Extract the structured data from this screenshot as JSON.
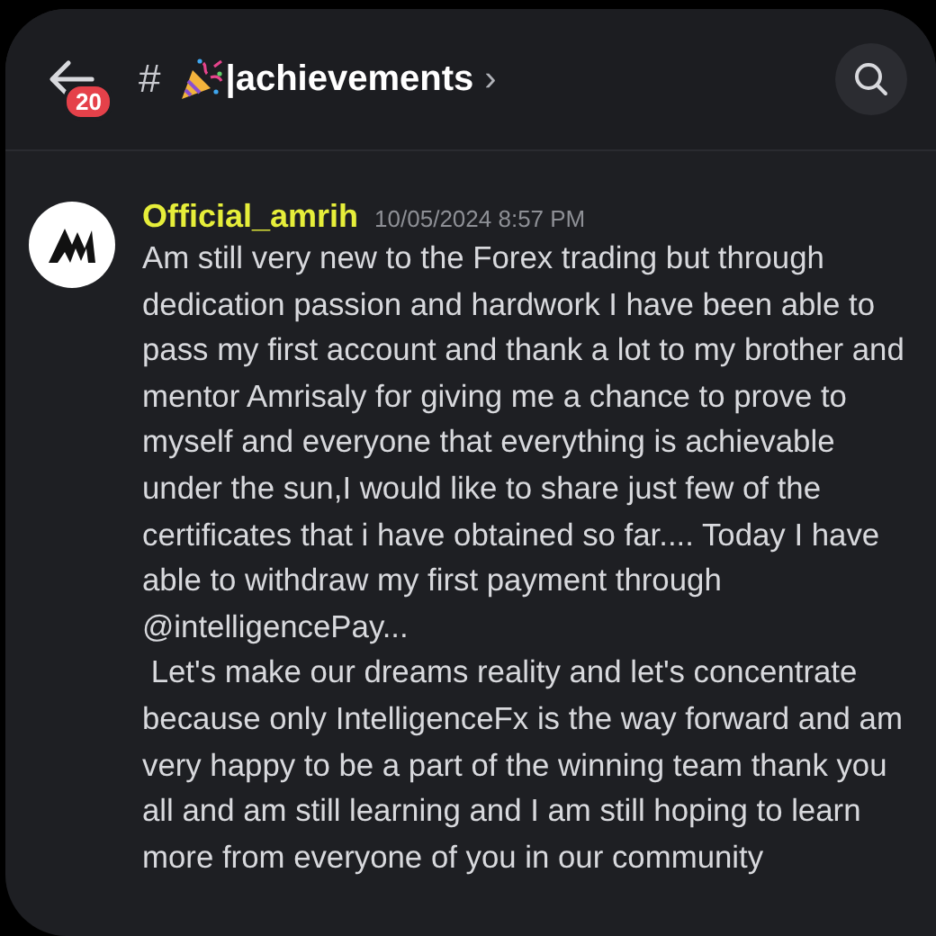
{
  "header": {
    "back_badge": "20",
    "hash": "#",
    "channel": "|achievements",
    "chevron": "›"
  },
  "message": {
    "author": "Official_amrih",
    "timestamp": "10/05/2024 8:57 PM",
    "paragraphs": [
      "Am still very new to the Forex trading but through dedication passion and hardwork I have been able to pass my first account and thank a lot to my brother and mentor Amrisaly for giving me a chance to prove to myself and everyone that everything is achievable under the sun,I would like to share just few of the certificates that i have obtained so far.... Today I have able to withdraw my first payment through  @intelligencePay...",
      " Let's make our dreams reality and let's concentrate because only IntelligenceFx is the way forward and am very happy to be a part of the winning team thank you all and am still learning and I am still hoping to learn more from everyone of you in our community"
    ]
  }
}
